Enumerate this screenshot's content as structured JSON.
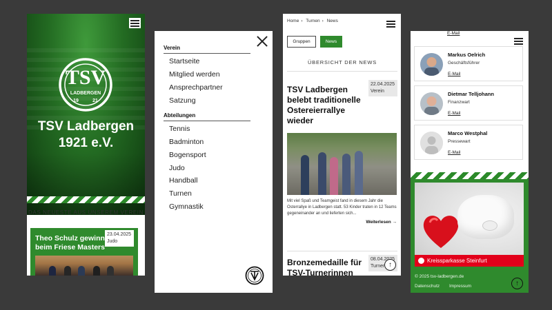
{
  "home": {
    "club_title_line1": "TSV Ladbergen",
    "club_title_line2": "1921 e.V.",
    "logo_text_top": "TSV",
    "logo_text_mid": "LADBERGEN",
    "logo_year_left": "19",
    "logo_year_right": "21",
    "section_title": "DAS NEUESTE AUS UNSEREM VEREIN",
    "featured": {
      "headline": "Theo Schulz gewinnt beim Friese Masters",
      "date": "23.04.2025",
      "category": "Judo"
    }
  },
  "menu": {
    "groups": [
      {
        "title": "Verein",
        "items": [
          "Startseite",
          "Mitglied werden",
          "Ansprechpartner",
          "Satzung"
        ]
      },
      {
        "title": "Abteilungen",
        "items": [
          "Tennis",
          "Badminton",
          "Bogensport",
          "Judo",
          "Handball",
          "Turnen",
          "Gymnastik"
        ]
      }
    ]
  },
  "news": {
    "breadcrumb": [
      "Home",
      "Turnen",
      "News"
    ],
    "filter_groups": "Gruppen",
    "filter_news": "News",
    "overview_title": "ÜBERSICHT DER NEWS",
    "articles": [
      {
        "title": "TSV Ladbergen belebt traditionelle Ostereierrallye wieder",
        "date": "22.04.2025",
        "category": "Verein",
        "excerpt": "Mit viel Spaß und Teamgeist fand in diesem Jahr die Osterrallye in Ladbergen statt. 53 Kinder traten in 12 Teams gegeneinander an und lieferten sich...",
        "more": "Weiterlesen"
      },
      {
        "title": "Bronzemedaille für TSV-Turnerinnen",
        "date": "08.04.2025",
        "category": "Turnen"
      }
    ]
  },
  "contacts": {
    "top_mail": "E-Mail",
    "people": [
      {
        "name": "Markus Oelrich",
        "role": "Geschäftsführer",
        "mail": "E-Mail"
      },
      {
        "name": "Dietmar Telljohann",
        "role": "Finanzwart",
        "mail": "E-Mail"
      },
      {
        "name": "Marco Westphal",
        "role": "Pressewart",
        "mail": "E-Mail"
      }
    ],
    "sponsor": "Kreissparkasse Steinfurt",
    "copyright": "© 2025 tsv-ladbergen.de",
    "footer_links": [
      "Datenschutz",
      "Impressum"
    ]
  },
  "colors": {
    "brand_green": "#2f8a2d",
    "sparkasse_red": "#e2001a"
  }
}
